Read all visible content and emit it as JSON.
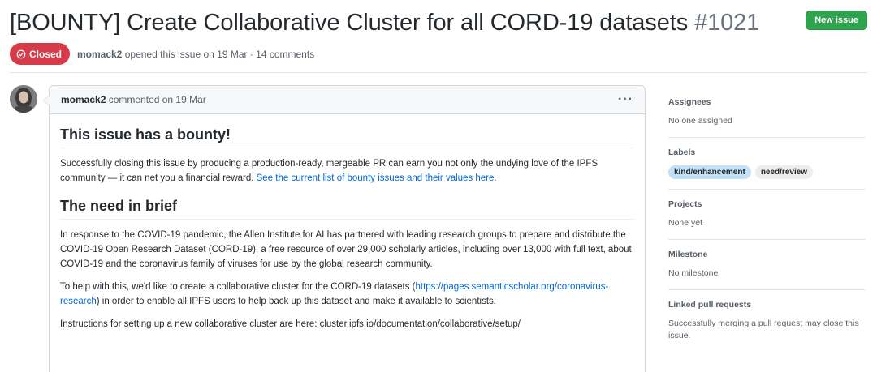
{
  "issue": {
    "title": "[BOUNTY] Create Collaborative Cluster for all CORD-19 datasets",
    "number": "#1021",
    "state": "Closed",
    "author": "momack2",
    "meta_text": "opened this issue on 19 Mar · 14 comments",
    "new_issue_label": "New issue"
  },
  "comment": {
    "author": "momack2",
    "meta": "commented on 19 Mar",
    "menu": "···",
    "heading1": "This issue has a bounty!",
    "p1_text": "Successfully closing this issue by producing a production-ready, mergeable PR can earn you not only the undying love of the IPFS community — it can net you a financial reward.",
    "p1_link": "See the current list of bounty issues and their values here.",
    "heading2": "The need in brief",
    "p2": "In response to the COVID-19 pandemic, the Allen Institute for AI has partnered with leading research groups to prepare and distribute the COVID-19 Open Research Dataset (CORD-19), a free resource of over 29,000 scholarly articles, including over 13,000 with full text, about COVID-19 and the coronavirus family of viruses for use by the global research community.",
    "p3_before": "To help with this, we'd like to create a collaborative cluster for the CORD-19 datasets (",
    "p3_link": "https://pages.semanticscholar.org/coronavirus-research",
    "p3_after": ") in order to enable all IPFS users to help back up this dataset and make it available to scientists.",
    "p4": "Instructions for setting up a new collaborative cluster are here: cluster.ipfs.io/documentation/collaborative/setup/"
  },
  "sidebar": {
    "assignees_heading": "Assignees",
    "assignees_value": "No one assigned",
    "labels_heading": "Labels",
    "labels": [
      {
        "name": "kind/enhancement",
        "bg": "#c2e0f6",
        "fg": "#24292e"
      },
      {
        "name": "need/review",
        "bg": "#ededed",
        "fg": "#24292e"
      }
    ],
    "projects_heading": "Projects",
    "projects_value": "None yet",
    "milestone_heading": "Milestone",
    "milestone_value": "No milestone",
    "linked_heading": "Linked pull requests",
    "linked_value": "Successfully merging a pull request may close this issue."
  },
  "colors": {
    "closed_red": "#d73a49",
    "new_issue_green": "#2ea44f",
    "link_blue": "#0366d6"
  }
}
